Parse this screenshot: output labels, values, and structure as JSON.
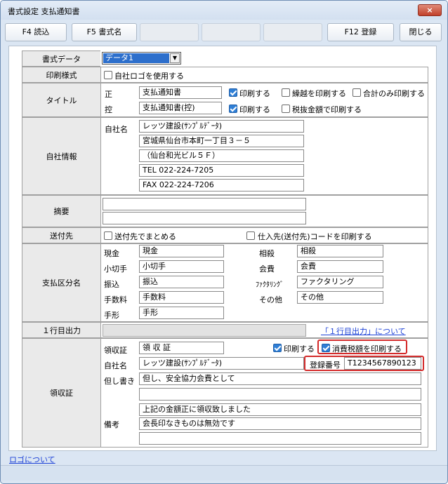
{
  "window": {
    "title": "書式設定 支払通知書",
    "close_label": "×"
  },
  "toolbar": {
    "f4": "F4 読込",
    "f5": "F5 書式名",
    "f12": "F12 登録",
    "close": "閉じる"
  },
  "format_data": {
    "label": "書式データ",
    "selected": "データ1"
  },
  "print_style": {
    "label": "印刷様式",
    "use_logo": "自社ロゴを使用する"
  },
  "title_row": {
    "label": "タイトル",
    "main_label": "正",
    "main_value": "支払通知書",
    "copy_label": "控",
    "copy_value": "支払通知書(控)",
    "print": "印刷する",
    "print_carry": "繰越を印刷する",
    "print_total_only": "合計のみ印刷する",
    "print_excl_tax": "税抜金額で印刷する"
  },
  "company": {
    "label": "自社情報",
    "name_label": "自社名",
    "lines": [
      "レッツ建設(ｻﾝﾌﾟﾙﾃﾞｰﾀ)",
      "宮城県仙台市本町一丁目３－５",
      "（仙台和光ビル５Ｆ）",
      "TEL 022-224-7205",
      "FAX 022-224-7206"
    ]
  },
  "summary": {
    "label": "摘要",
    "line1": "",
    "line2": ""
  },
  "send_to": {
    "label": "送付先",
    "combine": "送付先でまとめる",
    "print_code": "仕入先(送付先)コードを印刷する"
  },
  "payment": {
    "label": "支払区分名",
    "left": [
      {
        "label": "現金",
        "value": "現金"
      },
      {
        "label": "小切手",
        "value": "小切手"
      },
      {
        "label": "振込",
        "value": "振込"
      },
      {
        "label": "手数料",
        "value": "手数料"
      },
      {
        "label": "手形",
        "value": "手形"
      }
    ],
    "right": [
      {
        "label": "相殺",
        "value": "相殺"
      },
      {
        "label": "会費",
        "value": "会費"
      },
      {
        "label": "ﾌｧｸﾀﾘﾝｸﾞ",
        "value": "ファクタリング"
      },
      {
        "label": "その他",
        "value": "その他"
      }
    ]
  },
  "first_line": {
    "label": "１行目出力",
    "value": "",
    "link": "「１行目出力」について"
  },
  "receipt": {
    "label": "領収証",
    "title_label": "領収証",
    "title_value": "領 収 証",
    "print": "印刷する",
    "print_tax": "消費税額を印刷する",
    "company_label": "自社名",
    "company_value": "レッツ建設(ｻﾝﾌﾟﾙﾃﾞｰﾀ)",
    "reg_label": "登録番号",
    "reg_value": "T1234567890123",
    "proviso_label": "但し書き",
    "proviso1": "但し、安全協力会費として",
    "proviso2": "",
    "remarks_label": "備考",
    "remarks1": "上記の金額正に領収致しました",
    "remarks2": "会長印なきものは無効です",
    "remarks3": ""
  },
  "footer": {
    "logo_link": "ロゴについて"
  }
}
